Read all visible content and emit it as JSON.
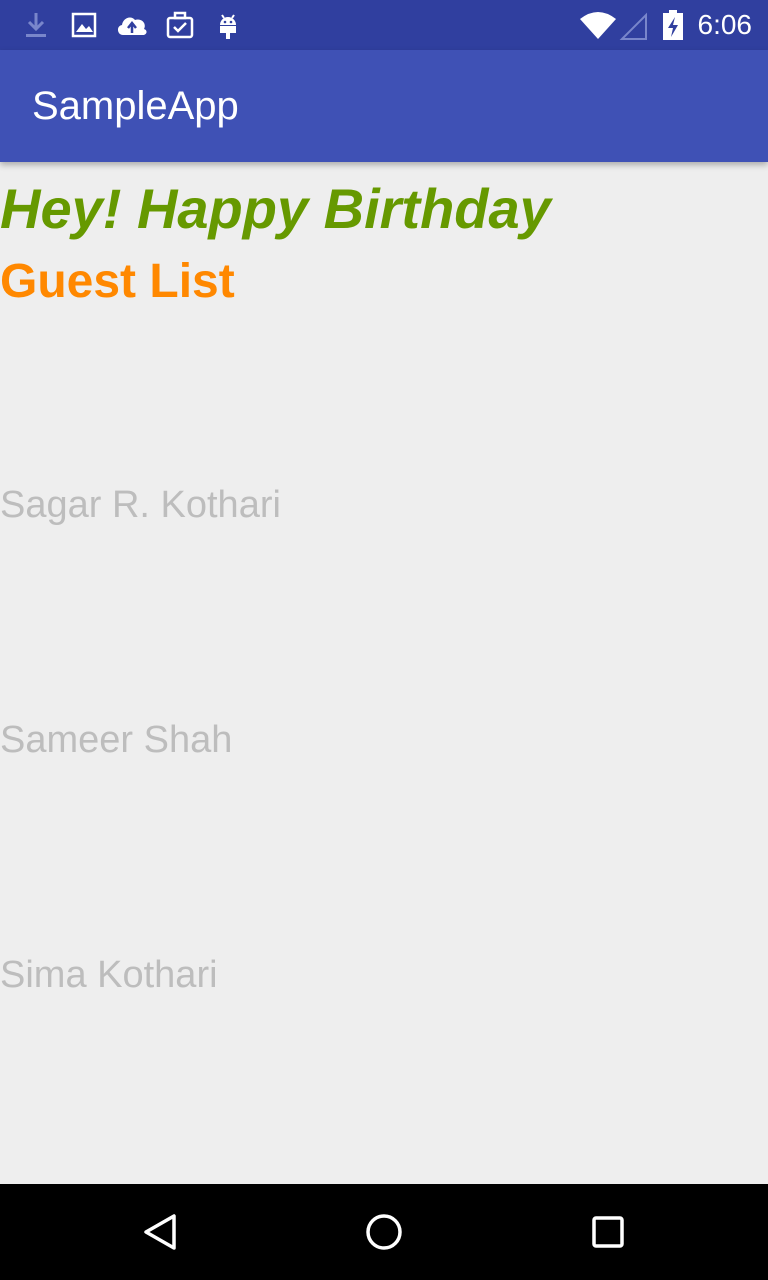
{
  "status_bar": {
    "time": "6:06",
    "icons": [
      "download-icon",
      "image-icon",
      "cloud-upload-icon",
      "briefcase-check-icon",
      "android-icon",
      "wifi-icon",
      "signal-icon",
      "battery-charging-icon"
    ]
  },
  "app_bar": {
    "title": "SampleApp"
  },
  "main": {
    "headline": "Hey! Happy Birthday",
    "subheading": "Guest List",
    "guests": [
      "Sagar R. Kothari",
      "Sameer Shah",
      "Sima Kothari"
    ]
  },
  "nav_bar": {
    "buttons": [
      "back-icon",
      "home-icon",
      "recents-icon"
    ]
  },
  "colors": {
    "status_bar": "#303f9f",
    "app_bar": "#3f51b5",
    "headline": "#669900",
    "subheading": "#ff8800",
    "guest_text": "#bdbdbd",
    "background": "#eeeeee"
  }
}
